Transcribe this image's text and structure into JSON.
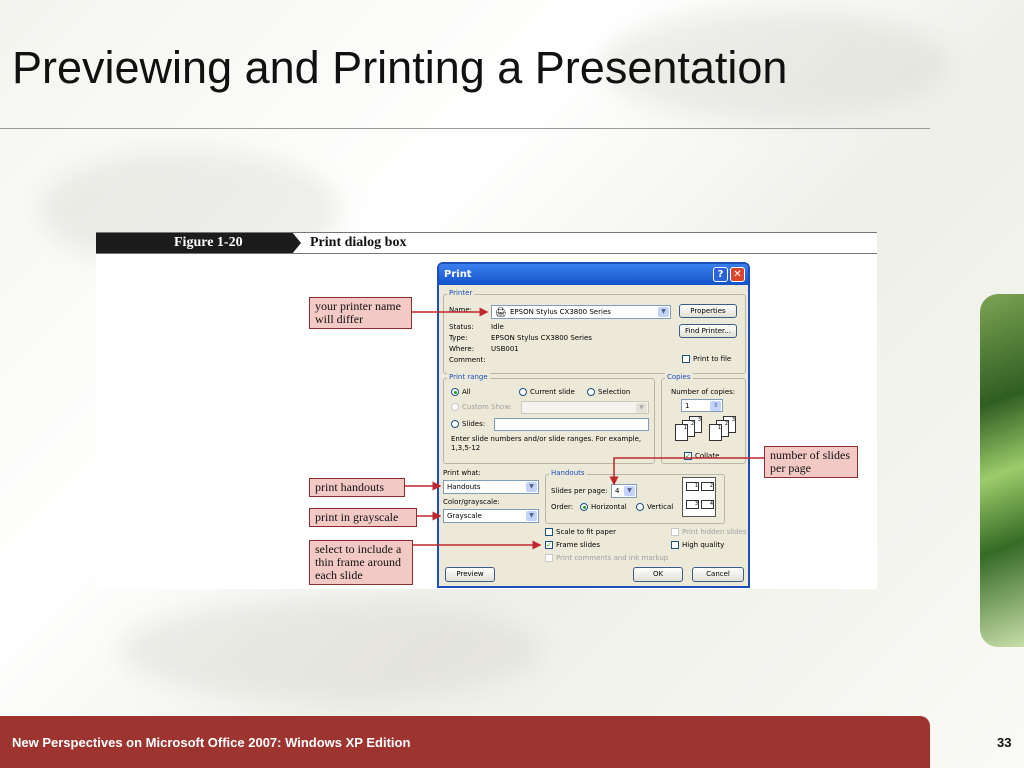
{
  "slide": {
    "title": "Previewing and Printing a Presentation",
    "footer": "New Perspectives on Microsoft Office 2007: Windows XP Edition",
    "page_number": "33"
  },
  "figure": {
    "number": "Figure 1-20",
    "caption": "Print dialog box"
  },
  "dialog": {
    "title": "Print",
    "printer_group": "Printer",
    "name_label": "Name:",
    "printer_name": "EPSON Stylus CX3800 Series",
    "properties_button": "Properties",
    "find_printer_button": "Find Printer...",
    "status_label": "Status:",
    "status_value": "Idle",
    "type_label": "Type:",
    "type_value": "EPSON Stylus CX3800 Series",
    "where_label": "Where:",
    "where_value": "USB001",
    "comment_label": "Comment:",
    "print_to_file": "Print to file",
    "print_range_group": "Print range",
    "all_label": "All",
    "current_slide_label": "Current slide",
    "selection_label": "Selection",
    "custom_show_label": "Custom Show:",
    "slides_label": "Slides:",
    "slides_hint": "Enter slide numbers and/or slide ranges. For example, 1,3,5-12",
    "copies_group": "Copies",
    "number_of_copies_label": "Number of copies:",
    "copies_value": "1",
    "collate_label": "Collate",
    "print_what_label": "Print what:",
    "print_what_value": "Handouts",
    "color_label": "Color/grayscale:",
    "color_value": "Grayscale",
    "handouts_group": "Handouts",
    "slides_per_page_label": "Slides per page:",
    "slides_per_page_value": "4",
    "order_label": "Order:",
    "horizontal_label": "Horizontal",
    "vertical_label": "Vertical",
    "scale_to_fit_label": "Scale to fit paper",
    "frame_slides_label": "Frame slides",
    "print_comments_label": "Print comments and ink markup",
    "print_hidden_label": "Print hidden slides",
    "high_quality_label": "High quality",
    "preview_button": "Preview",
    "ok_button": "OK",
    "cancel_button": "Cancel"
  },
  "callouts": {
    "printer_name": "your printer name will differ",
    "handouts": "print handouts",
    "grayscale": "print in grayscale",
    "frame": "select to include a thin frame around each slide",
    "slides_per_page": "number of slides per page"
  },
  "colors": {
    "footer": "#9e342f",
    "callout_fill": "#f3c9c6",
    "arrow": "#c0272d",
    "dialog_title": "#1453c9"
  }
}
